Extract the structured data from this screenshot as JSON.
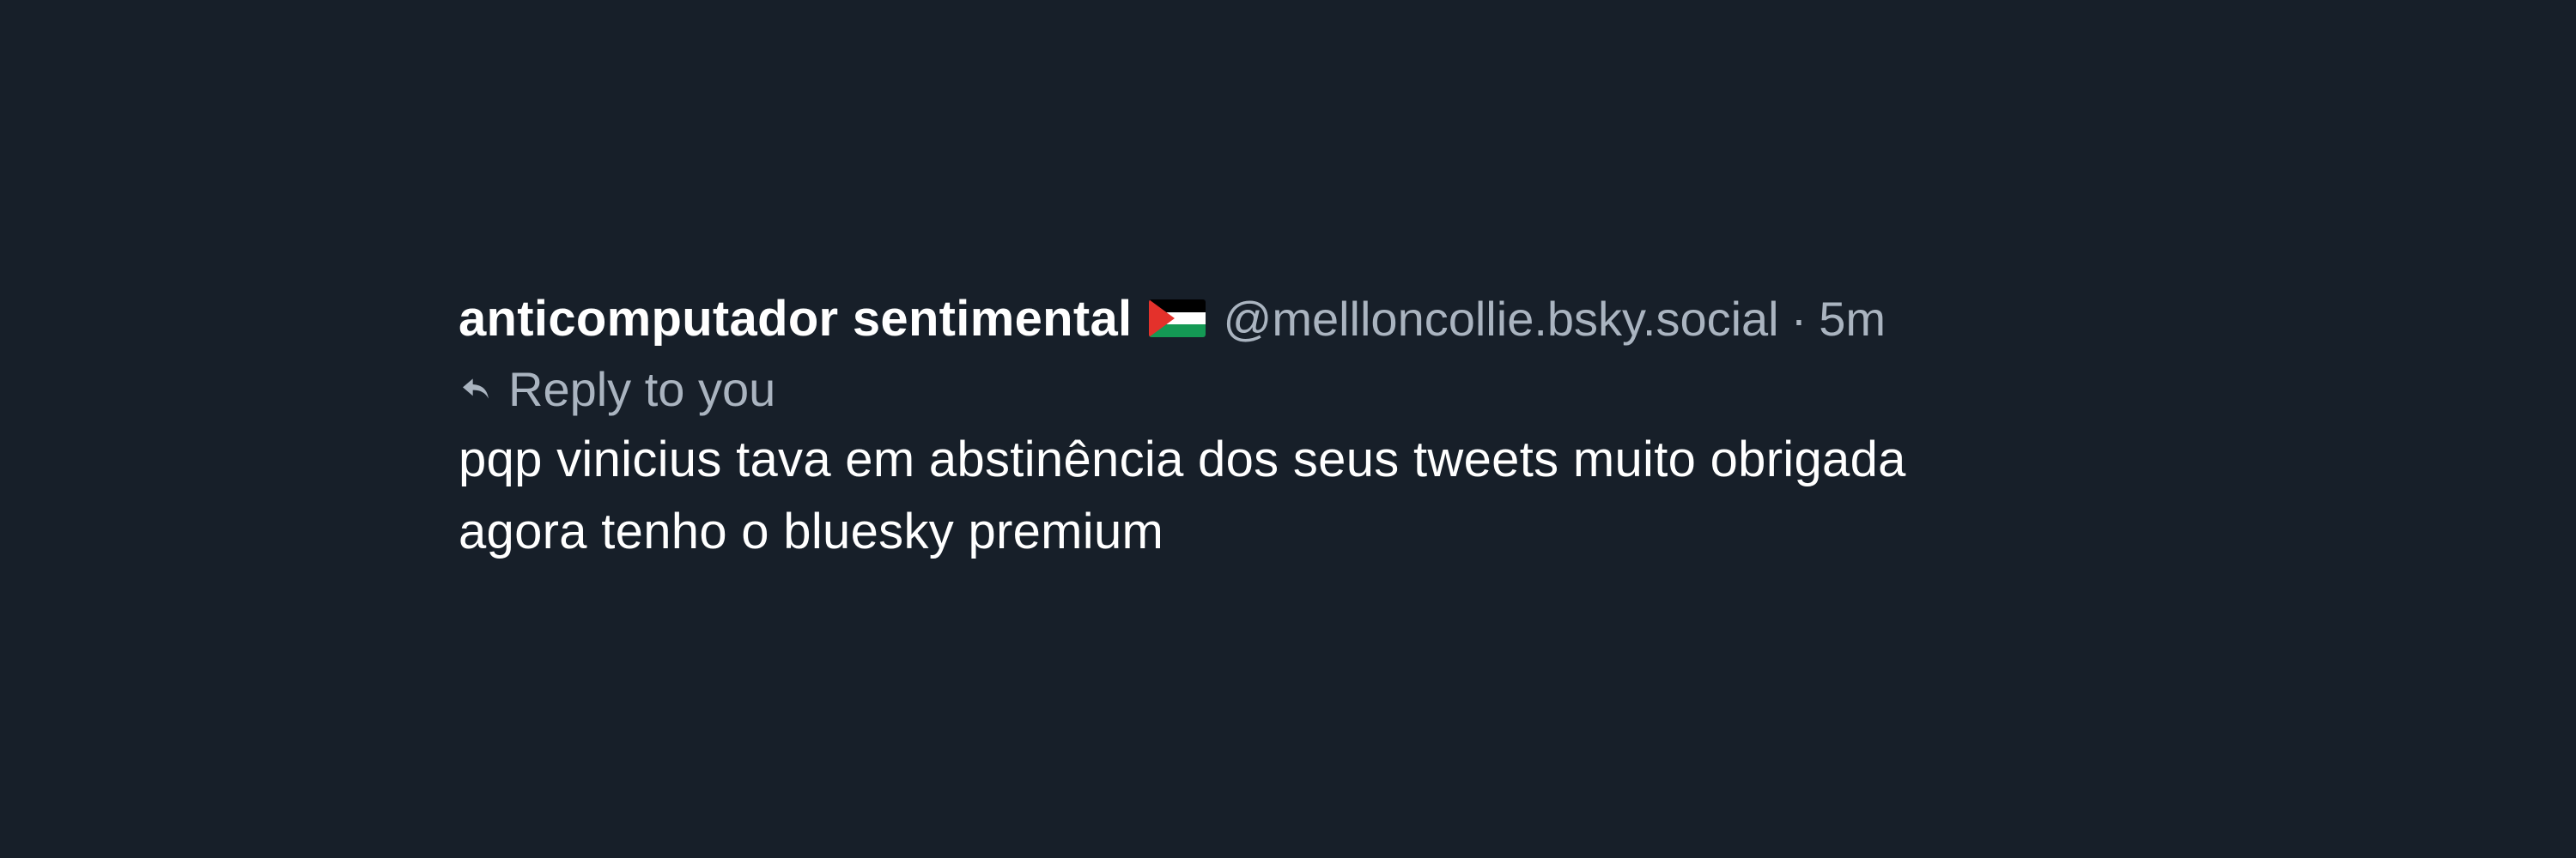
{
  "post": {
    "author": {
      "display_name": "anticomputador sentimental",
      "flag_icon": "palestine-flag-icon",
      "handle": "@mellloncollie.bsky.social"
    },
    "separator": "·",
    "timestamp": "5m",
    "reply": {
      "icon": "reply-arrow-icon",
      "label": "Reply to you"
    },
    "text_lines": [
      "pqp vinicius tava em abstinência dos seus tweets muito obrigada",
      "agora tenho o bluesky premium"
    ]
  },
  "colors": {
    "background": "#171f29",
    "primary_text": "#ffffff",
    "secondary_text": "#aab4c0"
  }
}
